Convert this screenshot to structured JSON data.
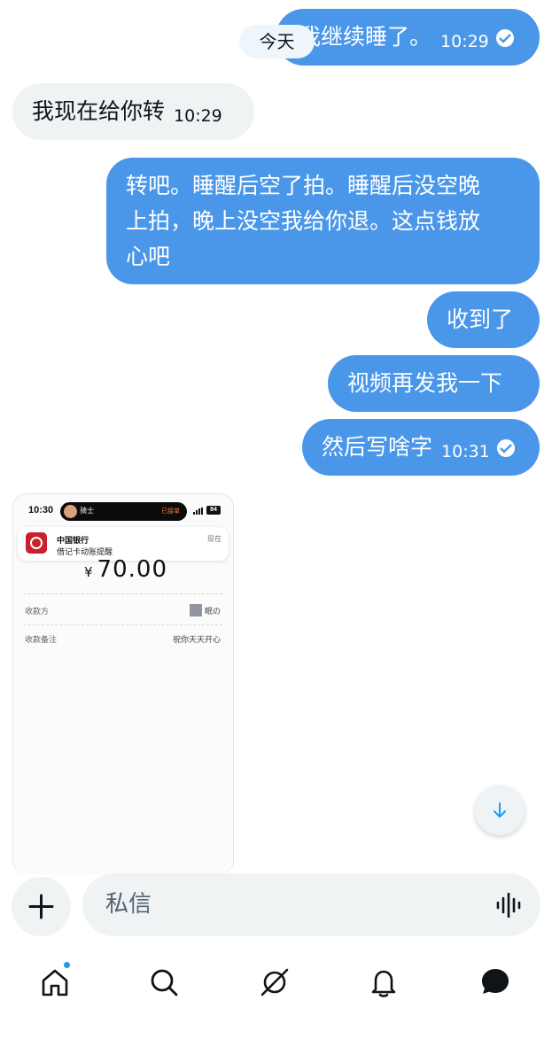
{
  "messages": [
    {
      "text": "我继续睡了。",
      "time": "10:29"
    },
    {
      "text": "我现在给你转",
      "time": "10:29"
    },
    {
      "line1": "转吧。睡醒后空了拍。睡醒后没空晚",
      "line2": "上拍，晚上没空我给你退。这点钱放",
      "line3": "心吧"
    },
    {
      "text": "收到了"
    },
    {
      "text": "视频再发我一下"
    },
    {
      "text": "然后写啥字",
      "time": "10:31"
    }
  ],
  "date_divider": "今天",
  "screenshot": {
    "status_time": "10:30",
    "island_name": "骑士",
    "island_status": "已接单",
    "battery": "84",
    "notification_title": "中国银行",
    "notification_body": "借记卡动账提醒",
    "notification_time": "现在",
    "currency": "¥",
    "amount": "70.00",
    "payee_label": "收款方",
    "payee_value": "眠の",
    "note_label": "收款备注",
    "note_value": "祝你天天开心"
  },
  "composer": {
    "placeholder": "私信"
  },
  "nav": {
    "items": [
      "home-icon",
      "search-icon",
      "grok-icon",
      "bell-icon",
      "messages-icon"
    ],
    "home_has_notification": true
  },
  "colors": {
    "outgoing": "#4a97e9",
    "incoming": "#eff3f4",
    "accent": "#1d9bf0"
  }
}
